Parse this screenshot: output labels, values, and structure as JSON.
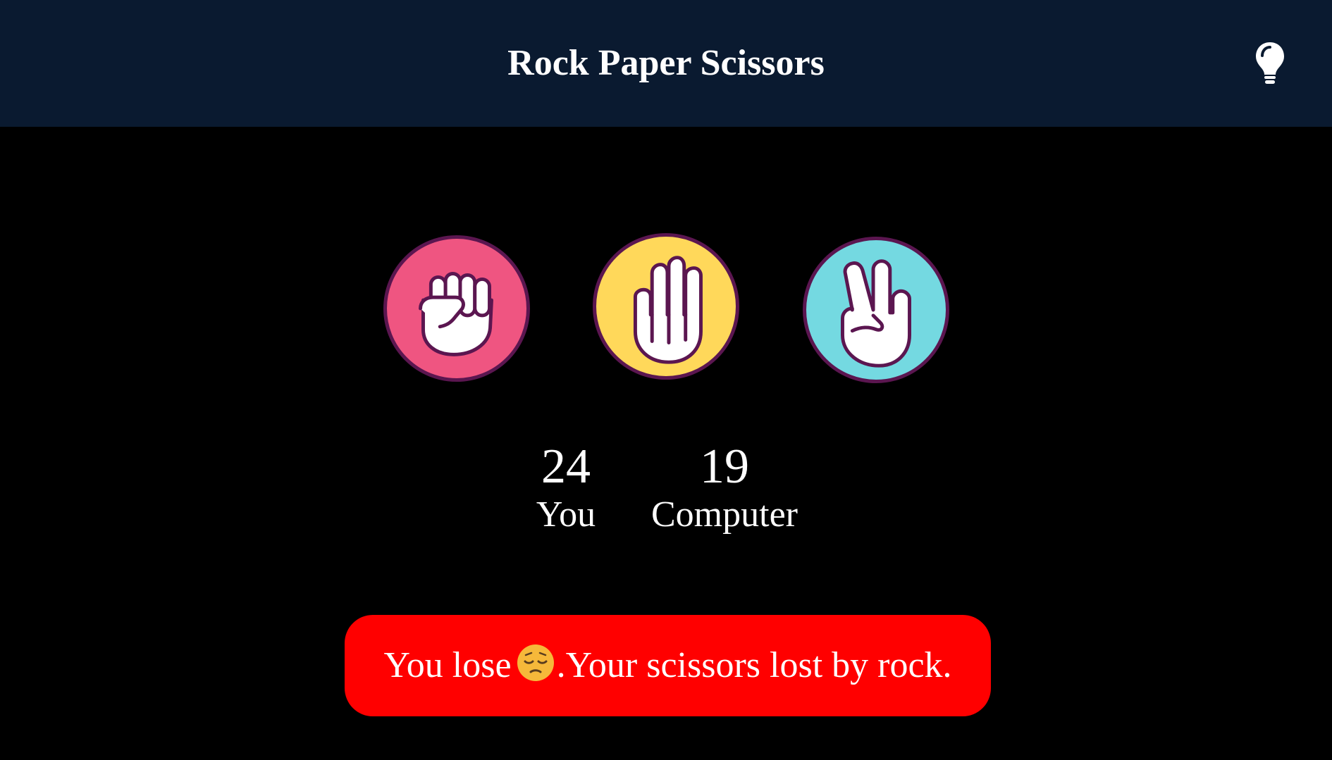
{
  "header": {
    "title": "Rock Paper Scissors",
    "theme_toggle_icon": "lightbulb-icon"
  },
  "choices": [
    {
      "name": "rock",
      "icon": "fist-icon",
      "color": "#ef5581"
    },
    {
      "name": "paper",
      "icon": "open-hand-icon",
      "color": "#ffd85a"
    },
    {
      "name": "scissors",
      "icon": "victory-hand-icon",
      "color": "#74d9e1"
    }
  ],
  "scores": {
    "you": {
      "value": "24",
      "label": "You"
    },
    "computer": {
      "value": "19",
      "label": "Computer"
    }
  },
  "result": {
    "prefix": "You lose",
    "emoji": "pensive-face-icon",
    "suffix": ".Your scissors lost by rock.",
    "color": "#ff0000"
  },
  "colors": {
    "header_bg": "#0a1a30",
    "page_bg": "#000000",
    "icon_outline": "#5b1650"
  }
}
